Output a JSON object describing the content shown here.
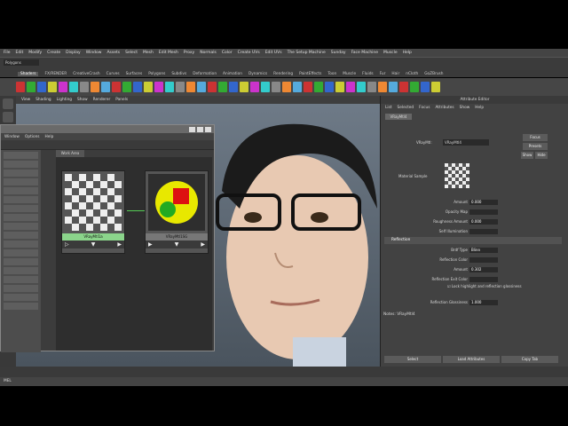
{
  "menubar": [
    "File",
    "Edit",
    "Modify",
    "Create",
    "Display",
    "Window",
    "Assets",
    "Select",
    "Mesh",
    "Edit Mesh",
    "Proxy",
    "Normals",
    "Color",
    "Create UVs",
    "Edit UVs",
    "The Setup Machine",
    "Sunday",
    "Face Machine",
    "Muscle",
    "Help"
  ],
  "mode_selector": "Polygons",
  "shelf_tabs": [
    "Shaders",
    "FX/RENDER",
    "CreativeCrash",
    "Curves",
    "Surfaces",
    "Polygons",
    "Subdivs",
    "Deformation",
    "Animation",
    "Dynamics",
    "Rendering",
    "PaintEffects",
    "Toon",
    "Muscle",
    "Fluids",
    "Fur",
    "Hair",
    "nCloth",
    "GoZBrush"
  ],
  "viewport_menu": [
    "View",
    "Shading",
    "Lighting",
    "Show",
    "Renderer",
    "Panels"
  ],
  "hypershade": {
    "menu": [
      "Window",
      "Options",
      "Help"
    ],
    "work_tab": "Work Area",
    "node1_label": "VRayMtl1a",
    "node2_label": "VRayMtl1SG"
  },
  "attr_editor": {
    "title": "Attribute Editor",
    "menu": [
      "List",
      "Selected",
      "Focus",
      "Attributes",
      "Show",
      "Help"
    ],
    "tab": "VRayMtl4",
    "vraymtl_label": "VRayMtl:",
    "vraymtl_value": "VRayMtl4",
    "focus_btn": "Focus",
    "presets_btn": "Presets",
    "show_btn": "Show",
    "hide_btn": "Hide",
    "material_sample": "Material Sample",
    "rows": [
      {
        "label": "Amount",
        "value": "0.000"
      },
      {
        "label": "Opacity Map",
        "value": ""
      },
      {
        "label": "Roughness Amount",
        "value": "0.000"
      },
      {
        "label": "Self Illumination",
        "value": ""
      }
    ],
    "reflection_section": "Reflection",
    "refl_rows": [
      {
        "label": "Brdf Type",
        "value": "Blinn"
      },
      {
        "label": "Reflection Color",
        "value": ""
      },
      {
        "label": "Amount",
        "value": "0.302"
      },
      {
        "label": "Reflection Exit Color",
        "value": ""
      }
    ],
    "lock_label": "Lock highlight and reflection glossiness",
    "glossiness_label": "Reflection Glossiness",
    "glossiness_value": "1.000",
    "notes_label": "Notes: VRayMtl4",
    "select_btn": "Select",
    "load_btn": "Load Attributes",
    "copy_btn": "Copy Tab"
  },
  "helpline": "MEL"
}
